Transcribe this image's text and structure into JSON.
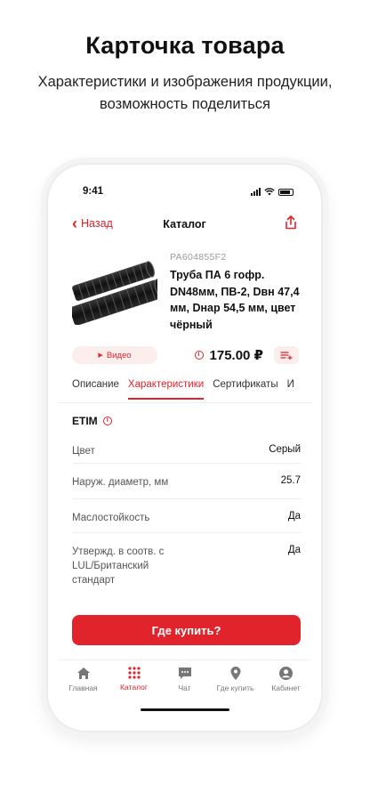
{
  "promo": {
    "title": "Карточка товара",
    "subtitle": "Характеристики и изображения продукции, возможность поделиться"
  },
  "status_bar": {
    "time": "9:41"
  },
  "nav": {
    "back_label": "Назад",
    "title": "Каталог",
    "share_icon": "share-icon"
  },
  "product": {
    "sku": "PA604855F2",
    "name": "Труба ПА 6 гофр. DN48мм, ПВ-2, Dвн 47,4 мм, Dнар 54,5 мм, цвет чёрный",
    "video_label": "Видео",
    "price": "175.00 ₽"
  },
  "tabs": [
    {
      "label": "Описание",
      "active": false
    },
    {
      "label": "Характеристики",
      "active": true
    },
    {
      "label": "Сертификаты",
      "active": false
    },
    {
      "label": "И",
      "active": false
    }
  ],
  "specs": {
    "section_title": "ETIM",
    "rows": [
      {
        "key": "Цвет",
        "value": "Серый"
      },
      {
        "key": "Наруж. диаметр, мм",
        "value": "25.7"
      },
      {
        "key": "Маслостойкость",
        "value": "Да"
      },
      {
        "key": "Утвержд. в соотв. с LUL/Британский стандарт",
        "value": "Да"
      }
    ]
  },
  "buy_button": "Где купить?",
  "tabbar": [
    {
      "label": "Главная",
      "icon": "home-icon",
      "active": false
    },
    {
      "label": "Каталог",
      "icon": "grid-icon",
      "active": true
    },
    {
      "label": "Чат",
      "icon": "chat-icon",
      "active": false
    },
    {
      "label": "Где купить",
      "icon": "location-pin-icon",
      "active": false
    },
    {
      "label": "Кабинет",
      "icon": "user-icon",
      "active": false
    }
  ],
  "colors": {
    "accent": "#e1232b",
    "accent_light": "#fdeeee",
    "text": "#111111"
  }
}
